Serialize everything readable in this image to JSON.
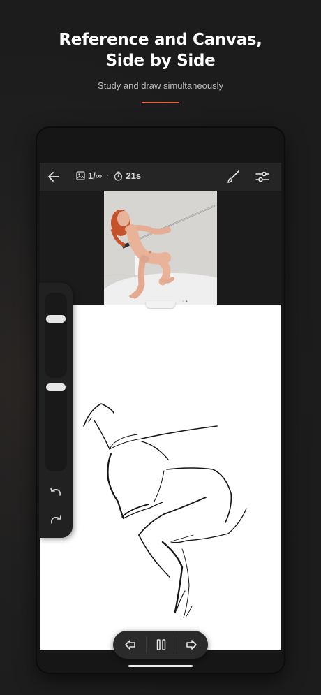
{
  "headline": {
    "line1": "Reference and Canvas,",
    "line2": "Side by Side"
  },
  "subtitle": "Study and draw simultaneously",
  "colors": {
    "accent": "#e0634a",
    "background": "#1f1f1f",
    "toolbar": "#252525",
    "canvas": "#ffffff"
  },
  "toolbar": {
    "back_icon": "arrow-left-icon",
    "image_icon": "image-icon",
    "counter": "1/∞",
    "separator": "·",
    "timer_icon": "timer-icon",
    "timer": "21s",
    "brush_icon": "brush-icon",
    "settings_icon": "sliders-icon"
  },
  "reference": {
    "subject_image": "photo-reference-pose"
  },
  "side_panel": {
    "brush_size_level": 0.82,
    "opacity_level": 0.82,
    "undo_icon": "undo-icon",
    "redo_icon": "redo-icon"
  },
  "playback": {
    "prev_icon": "arrow-left-box-icon",
    "pause_icon": "pause-icon",
    "next_icon": "arrow-right-box-icon"
  }
}
